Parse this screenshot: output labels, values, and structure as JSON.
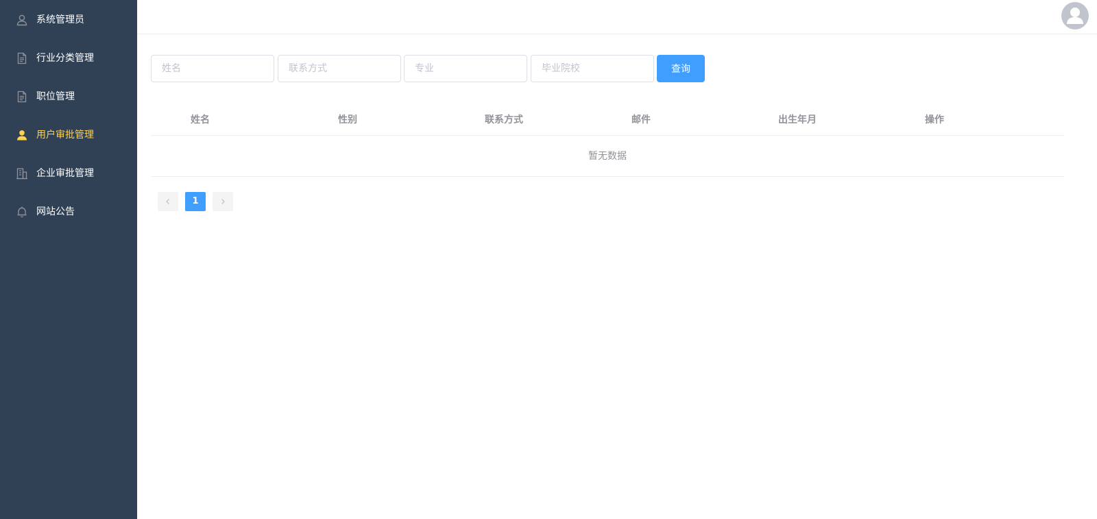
{
  "sidebar": {
    "background": "#304156",
    "active_color": "#ffd04b",
    "items": [
      {
        "label": "系统管理员",
        "icon": "user-outline-icon",
        "active": false
      },
      {
        "label": "行业分类管理",
        "icon": "document-icon",
        "active": false
      },
      {
        "label": "职位管理",
        "icon": "document-icon",
        "active": false
      },
      {
        "label": "用户审批管理",
        "icon": "user-solid-icon",
        "active": true
      },
      {
        "label": "企业审批管理",
        "icon": "office-building-icon",
        "active": false
      },
      {
        "label": "网站公告",
        "icon": "bell-icon",
        "active": false
      }
    ]
  },
  "header": {
    "avatar_icon": "avatar-icon"
  },
  "search": {
    "name_placeholder": "姓名",
    "phone_placeholder": "联系方式",
    "major_placeholder": "专业",
    "school_placeholder": "毕业院校",
    "query_label": "查询",
    "accent": "#409eff"
  },
  "table": {
    "columns": [
      "姓名",
      "性别",
      "联系方式",
      "邮件",
      "出生年月",
      "操作"
    ],
    "empty_text": "暂无数据"
  },
  "pagination": {
    "current_page": "1",
    "prev_icon": "chevron-left-icon",
    "next_icon": "chevron-right-icon"
  }
}
